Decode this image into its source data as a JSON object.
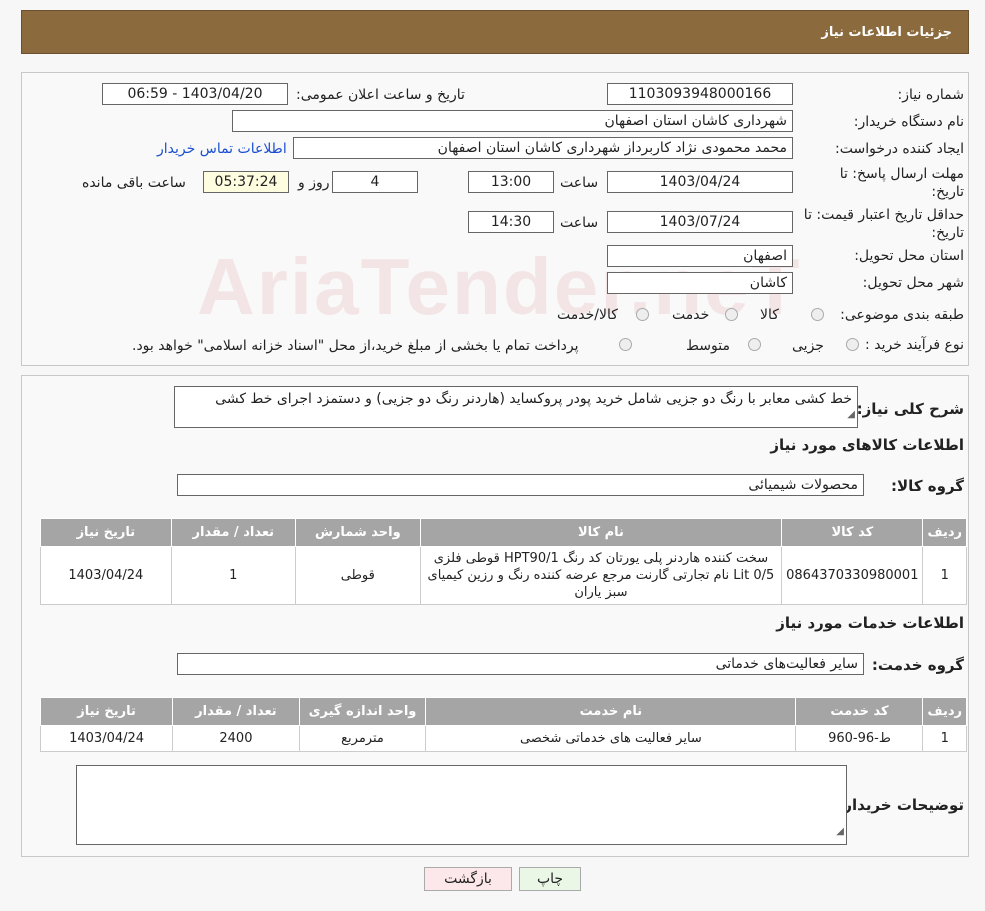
{
  "header": {
    "title": "جزئیات اطلاعات نیاز"
  },
  "watermark": "AriaTender.neT",
  "info": {
    "need_number_label": "شماره نیاز:",
    "need_number": "1103093948000166",
    "announce_label": "تاریخ و ساعت اعلان عمومی:",
    "announce_value": "1403/04/20 - 06:59",
    "buyer_org_label": "نام دستگاه خریدار:",
    "buyer_org": "شهرداری کاشان استان اصفهان",
    "creator_label": "ایجاد کننده درخواست:",
    "creator": "محمد محمودی نژاد کاربرداز شهرداری کاشان استان اصفهان",
    "contact_link": "اطلاعات تماس خریدار",
    "deadline_label": "مهلت ارسال پاسخ: تا تاریخ:",
    "deadline_date": "1403/04/24",
    "time_label": "ساعت",
    "deadline_time": "13:00",
    "days": "4",
    "days_label": "روز و",
    "remaining": "05:37:24",
    "remaining_label": "ساعت باقی مانده",
    "validity_label": "حداقل تاریخ اعتبار قیمت: تا تاریخ:",
    "validity_date": "1403/07/24",
    "validity_time": "14:30",
    "province_label": "استان محل تحویل:",
    "province": "اصفهان",
    "city_label": "شهر محل تحویل:",
    "city": "کاشان",
    "category_label": "طبقه بندی موضوعی:",
    "category_options": [
      "کالا",
      "خدمت",
      "کالا/خدمت"
    ],
    "process_label": "نوع فرآیند خرید :",
    "process_options": [
      "جزیی",
      "متوسط"
    ],
    "process_note": "پرداخت تمام یا بخشی از مبلغ خرید،از محل \"اسناد خزانه اسلامی\" خواهد بود."
  },
  "details": {
    "summary_label": "شرح کلی نیاز:",
    "summary": "خط کشی معابر با رنگ دو جزیی شامل خرید پودر پروکساید (هاردنر رنگ دو جزیی) و دستمزد اجرای خط کشی",
    "goods_title": "اطلاعات کالاهای مورد نیاز",
    "goods_group_label": "گروه کالا:",
    "goods_group": "محصولات شیمیائی",
    "goods_headers": [
      "ردیف",
      "کد کالا",
      "نام کالا",
      "واحد شمارش",
      "تعداد / مقدار",
      "تاریخ نیاز"
    ],
    "goods_rows": [
      [
        "1",
        "0864370330980001",
        "سخت کننده هاردنر پلی یورتان کد رنگ HPT90/1 قوطی فلزی 0/5 Lit نام تجارتی گارنت مرجع عرضه کننده رنگ و رزین کیمیای سبز یاران",
        "قوطی",
        "1",
        "1403/04/24"
      ]
    ],
    "services_title": "اطلاعات خدمات مورد نیاز",
    "service_group_label": "گروه خدمت:",
    "service_group": "سایر فعالیت‌های خدماتی",
    "service_headers": [
      "ردیف",
      "کد خدمت",
      "نام خدمت",
      "واحد اندازه گیری",
      "تعداد / مقدار",
      "تاریخ نیاز"
    ],
    "service_rows": [
      [
        "1",
        "ط-96-960",
        "سایر فعالیت های خدماتی شخصی",
        "مترمربع",
        "2400",
        "1403/04/24"
      ]
    ],
    "buyer_notes_label": "توضیحات خریدار:",
    "buyer_notes": ""
  },
  "buttons": {
    "print": "چاپ",
    "back": "بازگشت"
  }
}
